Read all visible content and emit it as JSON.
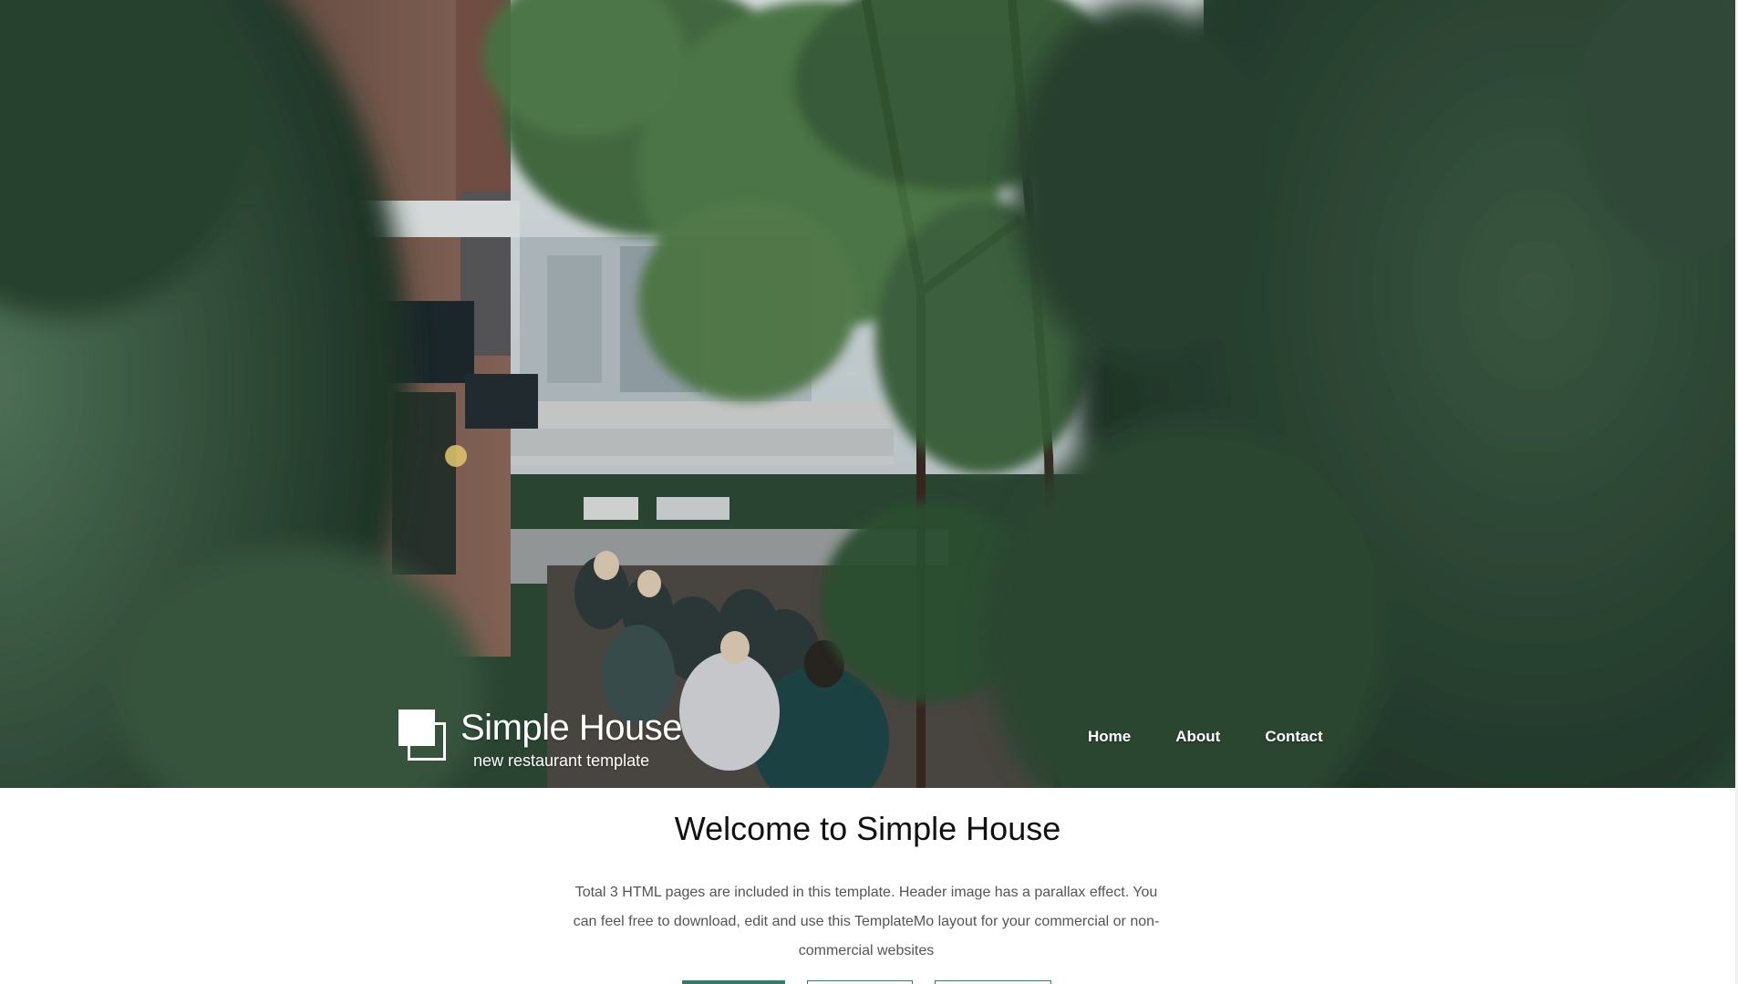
{
  "brand": {
    "title": "Simple House",
    "subtitle": "new restaurant template"
  },
  "nav": {
    "items": [
      {
        "label": "Home"
      },
      {
        "label": "About"
      },
      {
        "label": "Contact"
      }
    ]
  },
  "welcome": {
    "title": "Welcome to Simple House",
    "description": "Total 3 HTML pages are included in this template. Header image has a parallax effect. You can feel free to download, edit and use this TemplateMo layout for your commercial or non-commercial websites"
  },
  "colors": {
    "accent": "#2b7e69",
    "foliage": "#2f4a36"
  },
  "icons": {
    "logo": "overlapping-squares-icon"
  }
}
